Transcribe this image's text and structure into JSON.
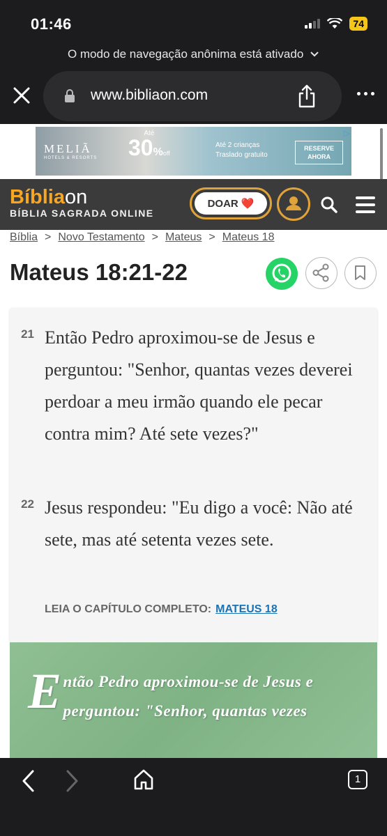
{
  "status_bar": {
    "time": "01:46",
    "battery": "74"
  },
  "browser": {
    "incognito_notice": "O modo de navegação anônima está ativado",
    "url": "www.bibliaon.com",
    "tab_count": "1"
  },
  "ad": {
    "brand": "MELIÃ",
    "brand_sub": "HOTELS & RESORTS",
    "offer_prefix": "Até",
    "offer_value": "30",
    "offer_pct": "%",
    "offer_suffix": "off",
    "line1": "Até 2 crianças",
    "line2": "Traslado gratuito",
    "cta_line1": "RESERVE",
    "cta_line2": "AHORA"
  },
  "site": {
    "brand_a": "Bíblia",
    "brand_b": "on",
    "tagline": "BÍBLIA SAGRADA ONLINE",
    "donate_label": "DOAR",
    "donate_emoji": "❤️"
  },
  "breadcrumb": {
    "items": [
      "Bíblia",
      "Novo Testamento",
      "Mateus",
      "Mateus 18"
    ],
    "separator": ">"
  },
  "page": {
    "title": "Mateus 18:21-22"
  },
  "verses": [
    {
      "number": "21",
      "text": "Então Pedro aproximou-se de Jesus e perguntou: \"Senhor, quantas vezes deverei perdoar a meu irmão quando ele pecar contra mim? Até sete vezes?\""
    },
    {
      "number": "22",
      "text": "Jesus respondeu: \"Eu digo a você: Não até sete, mas até setenta vezes sete."
    }
  ],
  "read_more": {
    "label": "LEIA O CAPÍTULO COMPLETO:",
    "link": "MATEUS 18"
  },
  "image_card": {
    "dropcap": "E",
    "text": "ntão Pedro aproximou-se de Jesus e perguntou: \"Senhor, quantas vezes"
  }
}
